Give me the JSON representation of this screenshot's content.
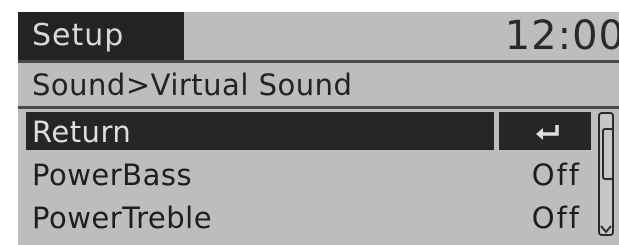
{
  "header": {
    "title": "Setup",
    "clock": "12:00"
  },
  "breadcrumb": "Sound>Virtual Sound",
  "menu": {
    "items": [
      {
        "label": "Return",
        "value": "",
        "icon": "return-arrow-icon",
        "selected": true
      },
      {
        "label": "PowerBass",
        "value": "Off",
        "selected": false
      },
      {
        "label": "PowerTreble",
        "value": "Off",
        "selected": false
      }
    ]
  },
  "colors": {
    "background": "#bdbdbd",
    "selected_bg": "#262626",
    "text": "#1e1e1e",
    "selected_text": "#dedede"
  }
}
